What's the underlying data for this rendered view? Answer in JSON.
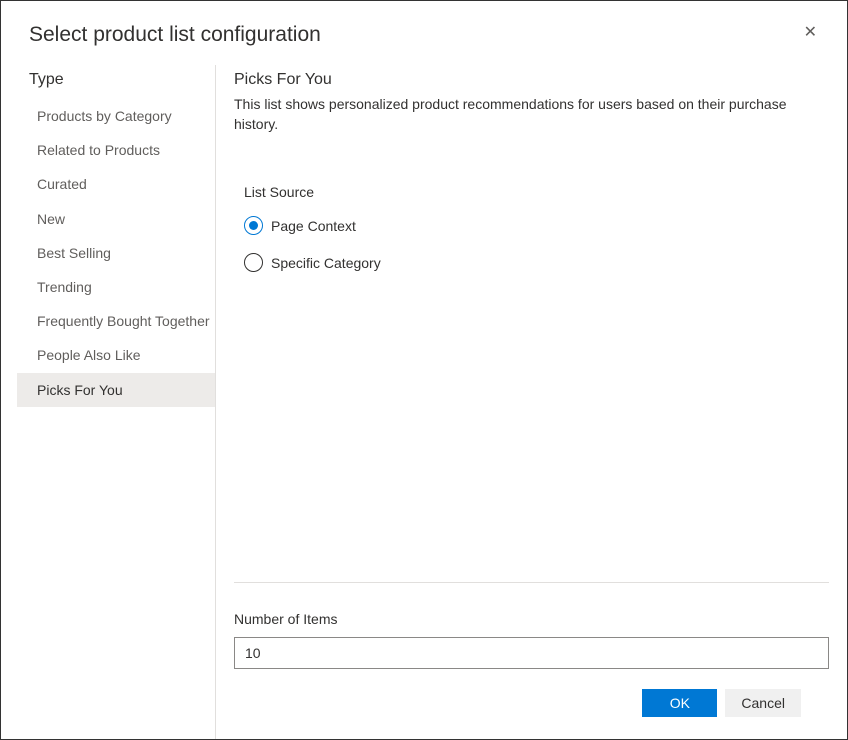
{
  "dialog": {
    "title": "Select product list configuration"
  },
  "sidebar": {
    "heading": "Type",
    "items": [
      {
        "label": "Products by Category",
        "selected": false
      },
      {
        "label": "Related to Products",
        "selected": false
      },
      {
        "label": "Curated",
        "selected": false
      },
      {
        "label": "New",
        "selected": false
      },
      {
        "label": "Best Selling",
        "selected": false
      },
      {
        "label": "Trending",
        "selected": false
      },
      {
        "label": "Frequently Bought Together",
        "selected": false
      },
      {
        "label": "People Also Like",
        "selected": false
      },
      {
        "label": "Picks For You",
        "selected": true
      }
    ]
  },
  "main": {
    "title": "Picks For You",
    "description": "This list shows personalized product recommendations for users based on their purchase history.",
    "list_source": {
      "label": "List Source",
      "options": [
        {
          "label": "Page Context",
          "checked": true
        },
        {
          "label": "Specific Category",
          "checked": false
        }
      ]
    },
    "number_of_items": {
      "label": "Number of Items",
      "value": "10"
    }
  },
  "footer": {
    "ok_label": "OK",
    "cancel_label": "Cancel"
  }
}
